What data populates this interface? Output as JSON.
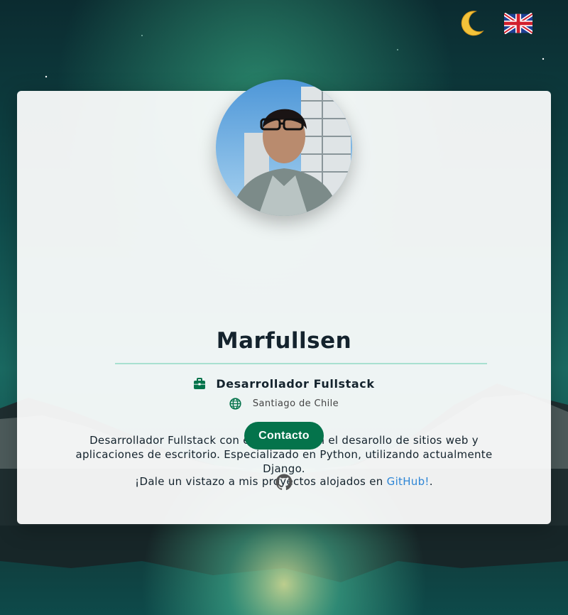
{
  "controls": {
    "theme_icon": "moon-icon",
    "language_icon": "uk-flag-icon"
  },
  "profile": {
    "name": "Marfullsen",
    "role": "Desarrollador Fullstack",
    "role_icon": "briefcase-icon",
    "location": "Santiago de Chile",
    "location_icon": "globe-icon",
    "description": "Desarrollador Fullstack con experiencia en el desarollo de sitios web y aplicaciones de escritorio. Especializado en Python, utilizando actualmente Django.",
    "cta_prefix": "¡Dale un vistazo a mis proyectos alojados en ",
    "cta_link": "GitHub!",
    "cta_suffix": ".",
    "contact_label": "Contacto",
    "social_icon": "github-icon"
  },
  "colors": {
    "accent": "#04734b",
    "link": "#2e86d6",
    "divider": "#a8e0d0"
  }
}
